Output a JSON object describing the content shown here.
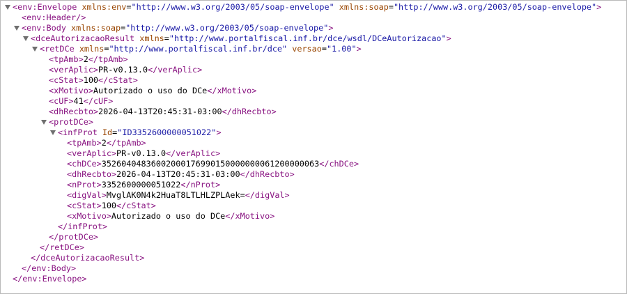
{
  "lines": [
    {
      "toggle": true,
      "parts": [
        [
          "tag",
          "<env:Envelope"
        ],
        [
          "text",
          " "
        ],
        [
          "attr-name",
          "xmlns:env"
        ],
        [
          "text",
          "="
        ],
        [
          "attr-value",
          "\"http://www.w3.org/2003/05/soap-envelope\""
        ],
        [
          "text",
          " "
        ],
        [
          "attr-name",
          "xmlns:soap"
        ],
        [
          "text",
          "="
        ],
        [
          "attr-value",
          "\"http://www.w3.org/2003/05/soap-envelope\""
        ],
        [
          "tag",
          ">"
        ]
      ]
    },
    {
      "toggle": false,
      "parts": [
        [
          "tag",
          "<env:Header/>"
        ]
      ]
    },
    {
      "toggle": true,
      "parts": [
        [
          "tag",
          "<env:Body"
        ],
        [
          "text",
          " "
        ],
        [
          "attr-name",
          "xmlns:soap"
        ],
        [
          "text",
          "="
        ],
        [
          "attr-value",
          "\"http://www.w3.org/2003/05/soap-envelope\""
        ],
        [
          "tag",
          ">"
        ]
      ]
    },
    {
      "toggle": true,
      "parts": [
        [
          "tag",
          "<dceAutorizacaoResult"
        ],
        [
          "text",
          " "
        ],
        [
          "attr-name",
          "xmlns"
        ],
        [
          "text",
          "="
        ],
        [
          "attr-value",
          "\"http://www.portalfiscal.inf.br/dce/wsdl/DCeAutorizacao\""
        ],
        [
          "tag",
          ">"
        ]
      ]
    },
    {
      "toggle": true,
      "parts": [
        [
          "tag",
          "<retDCe"
        ],
        [
          "text",
          " "
        ],
        [
          "attr-name",
          "xmlns"
        ],
        [
          "text",
          "="
        ],
        [
          "attr-value",
          "\"http://www.portalfiscal.inf.br/dce\""
        ],
        [
          "text",
          " "
        ],
        [
          "attr-name",
          "versao"
        ],
        [
          "text",
          "="
        ],
        [
          "attr-value",
          "\"1.00\""
        ],
        [
          "tag",
          ">"
        ]
      ]
    },
    {
      "toggle": false,
      "parts": [
        [
          "tag",
          "<tpAmb>"
        ],
        [
          "text",
          "2"
        ],
        [
          "tag",
          "</tpAmb>"
        ]
      ]
    },
    {
      "toggle": false,
      "parts": [
        [
          "tag",
          "<verAplic>"
        ],
        [
          "text",
          "PR-v0.13.0"
        ],
        [
          "tag",
          "</verAplic>"
        ]
      ]
    },
    {
      "toggle": false,
      "parts": [
        [
          "tag",
          "<cStat>"
        ],
        [
          "text",
          "100"
        ],
        [
          "tag",
          "</cStat>"
        ]
      ]
    },
    {
      "toggle": false,
      "parts": [
        [
          "tag",
          "<xMotivo>"
        ],
        [
          "text",
          "Autorizado o uso do DCe"
        ],
        [
          "tag",
          "</xMotivo>"
        ]
      ]
    },
    {
      "toggle": false,
      "parts": [
        [
          "tag",
          "<cUF>"
        ],
        [
          "text",
          "41"
        ],
        [
          "tag",
          "</cUF>"
        ]
      ]
    },
    {
      "toggle": false,
      "parts": [
        [
          "tag",
          "<dhRecbto>"
        ],
        [
          "text",
          "2026-04-13T20:45:31-03:00"
        ],
        [
          "tag",
          "</dhRecbto>"
        ]
      ]
    },
    {
      "toggle": true,
      "parts": [
        [
          "tag",
          "<protDCe>"
        ]
      ]
    },
    {
      "toggle": true,
      "parts": [
        [
          "tag",
          "<infProt"
        ],
        [
          "text",
          " "
        ],
        [
          "attr-name",
          "Id"
        ],
        [
          "text",
          "="
        ],
        [
          "attr-value",
          "\"ID3352600000051022\""
        ],
        [
          "tag",
          ">"
        ]
      ]
    },
    {
      "toggle": false,
      "parts": [
        [
          "tag",
          "<tpAmb>"
        ],
        [
          "text",
          "2"
        ],
        [
          "tag",
          "</tpAmb>"
        ]
      ]
    },
    {
      "toggle": false,
      "parts": [
        [
          "tag",
          "<verAplic>"
        ],
        [
          "text",
          "PR-v0.13.0"
        ],
        [
          "tag",
          "</verAplic>"
        ]
      ]
    },
    {
      "toggle": false,
      "parts": [
        [
          "tag",
          "<chDCe>"
        ],
        [
          "text",
          "35260404836002000176990150000000061200000063"
        ],
        [
          "tag",
          "</chDCe>"
        ]
      ]
    },
    {
      "toggle": false,
      "parts": [
        [
          "tag",
          "<dhRecbto>"
        ],
        [
          "text",
          "2026-04-13T20:45:31-03:00"
        ],
        [
          "tag",
          "</dhRecbto>"
        ]
      ]
    },
    {
      "toggle": false,
      "parts": [
        [
          "tag",
          "<nProt>"
        ],
        [
          "text",
          "3352600000051022"
        ],
        [
          "tag",
          "</nProt>"
        ]
      ]
    },
    {
      "toggle": false,
      "parts": [
        [
          "tag",
          "<digVal>"
        ],
        [
          "text",
          "MvglAK0N4k2HuaT8LTLHLZPLAek="
        ],
        [
          "tag",
          "</digVal>"
        ]
      ]
    },
    {
      "toggle": false,
      "parts": [
        [
          "tag",
          "<cStat>"
        ],
        [
          "text",
          "100"
        ],
        [
          "tag",
          "</cStat>"
        ]
      ]
    },
    {
      "toggle": false,
      "parts": [
        [
          "tag",
          "<xMotivo>"
        ],
        [
          "text",
          "Autorizado o uso do DCe"
        ],
        [
          "tag",
          "</xMotivo>"
        ]
      ]
    },
    {
      "toggle": false,
      "parts": [
        [
          "tag",
          "</infProt>"
        ]
      ]
    },
    {
      "toggle": false,
      "parts": [
        [
          "tag",
          "</protDCe>"
        ]
      ]
    },
    {
      "toggle": false,
      "parts": [
        [
          "tag",
          "</retDCe>"
        ]
      ]
    },
    {
      "toggle": false,
      "parts": [
        [
          "tag",
          "</dceAutorizacaoResult>"
        ]
      ]
    },
    {
      "toggle": false,
      "parts": [
        [
          "tag",
          "</env:Body>"
        ]
      ]
    },
    {
      "toggle": false,
      "parts": [
        [
          "tag",
          "</env:Envelope>"
        ]
      ]
    }
  ]
}
